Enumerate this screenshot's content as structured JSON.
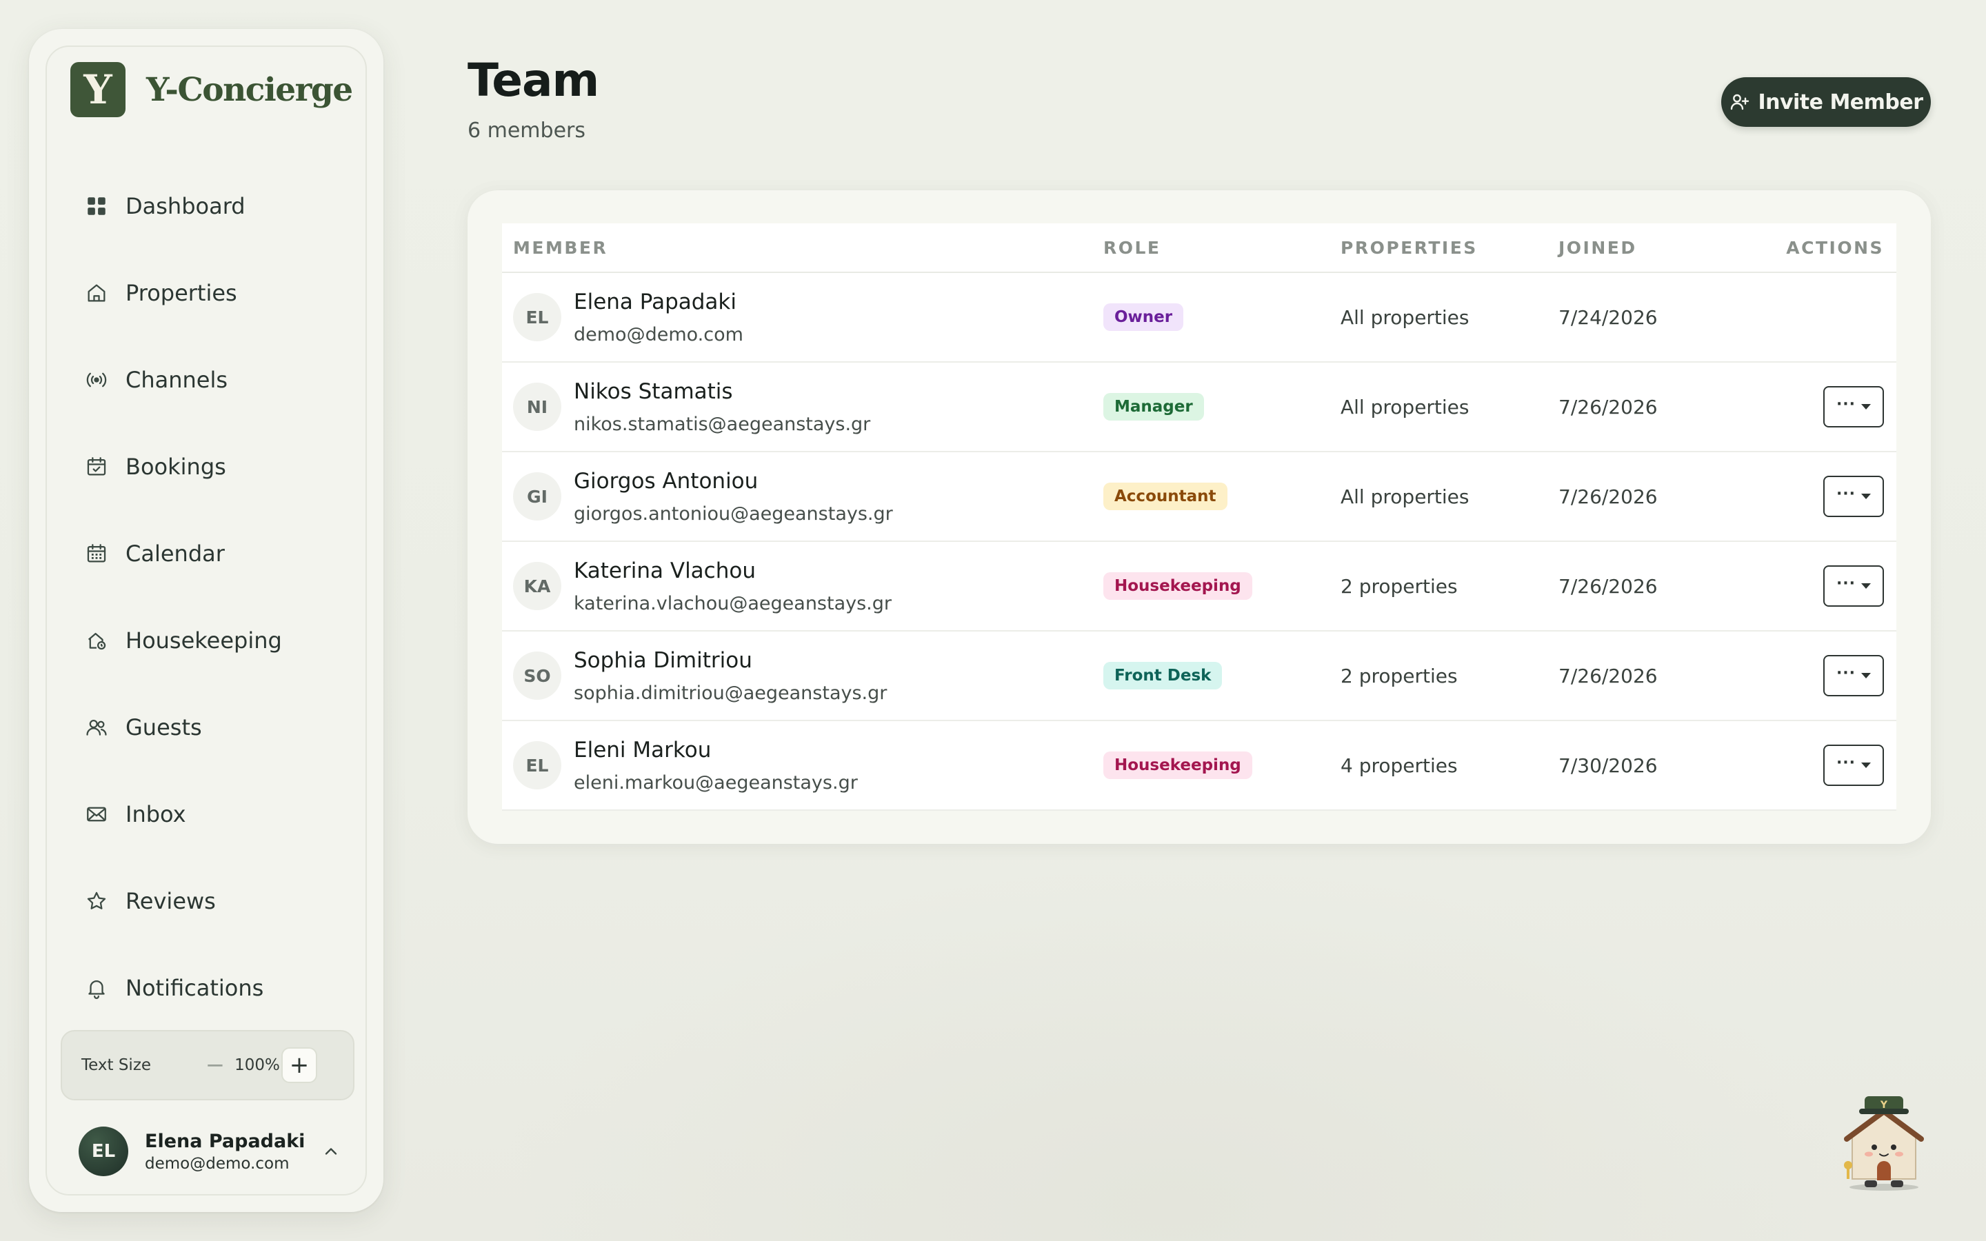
{
  "brand": {
    "logo_letter": "Y",
    "name": "Y-Concierge"
  },
  "sidebar": {
    "items": [
      {
        "label": "Dashboard",
        "icon": "grid-icon"
      },
      {
        "label": "Properties",
        "icon": "home-icon"
      },
      {
        "label": "Channels",
        "icon": "broadcast-icon"
      },
      {
        "label": "Bookings",
        "icon": "calendar-check-icon"
      },
      {
        "label": "Calendar",
        "icon": "calendar-icon"
      },
      {
        "label": "Housekeeping",
        "icon": "house-clean-icon"
      },
      {
        "label": "Guests",
        "icon": "users-icon"
      },
      {
        "label": "Inbox",
        "icon": "mail-icon"
      },
      {
        "label": "Reviews",
        "icon": "star-icon"
      },
      {
        "label": "Notifications",
        "icon": "bell-icon"
      }
    ],
    "text_size": {
      "label": "Text Size",
      "minus": "−",
      "value": "100%",
      "plus": "+"
    },
    "user": {
      "initials": "EL",
      "name": "Elena Papadaki",
      "email": "demo@demo.com"
    }
  },
  "header": {
    "title": "Team",
    "subtitle": "6 members",
    "invite_label": "Invite Member"
  },
  "table": {
    "columns": [
      "MEMBER",
      "ROLE",
      "PROPERTIES",
      "JOINED",
      "ACTIONS"
    ],
    "rows": [
      {
        "initials": "EL",
        "name": "Elena Papadaki",
        "email": "demo@demo.com",
        "role": "Owner",
        "properties": "All properties",
        "joined": "7/24/2026",
        "actions": false
      },
      {
        "initials": "NI",
        "name": "Nikos Stamatis",
        "email": "nikos.stamatis@aegeanstays.gr",
        "role": "Manager",
        "properties": "All properties",
        "joined": "7/26/2026",
        "actions": true
      },
      {
        "initials": "GI",
        "name": "Giorgos Antoniou",
        "email": "giorgos.antoniou@aegeanstays.gr",
        "role": "Accountant",
        "properties": "All properties",
        "joined": "7/26/2026",
        "actions": true
      },
      {
        "initials": "KA",
        "name": "Katerina Vlachou",
        "email": "katerina.vlachou@aegeanstays.gr",
        "role": "Housekeeping",
        "properties": "2 properties",
        "joined": "7/26/2026",
        "actions": true
      },
      {
        "initials": "SO",
        "name": "Sophia Dimitriou",
        "email": "sophia.dimitriou@aegeanstays.gr",
        "role": "Front Desk",
        "properties": "2 properties",
        "joined": "7/26/2026",
        "actions": true
      },
      {
        "initials": "EL",
        "name": "Eleni Markou",
        "email": "eleni.markou@aegeanstays.gr",
        "role": "Housekeeping",
        "properties": "4 properties",
        "joined": "7/30/2026",
        "actions": true
      }
    ]
  },
  "role_colors": {
    "Owner": {
      "bg": "#f1e4fb",
      "fg": "#6a1f9a"
    },
    "Manager": {
      "bg": "#dcf5e3",
      "fg": "#1d6a36"
    },
    "Accountant": {
      "bg": "#fdf0c8",
      "fg": "#8a4a0a"
    },
    "Housekeeping": {
      "bg": "#fde4ee",
      "fg": "#a3164f"
    },
    "Front Desk": {
      "bg": "#d6f5ef",
      "fg": "#0e6358"
    }
  },
  "colors": {
    "accent": "#3f5638",
    "button_dark": "#2c3a30"
  }
}
